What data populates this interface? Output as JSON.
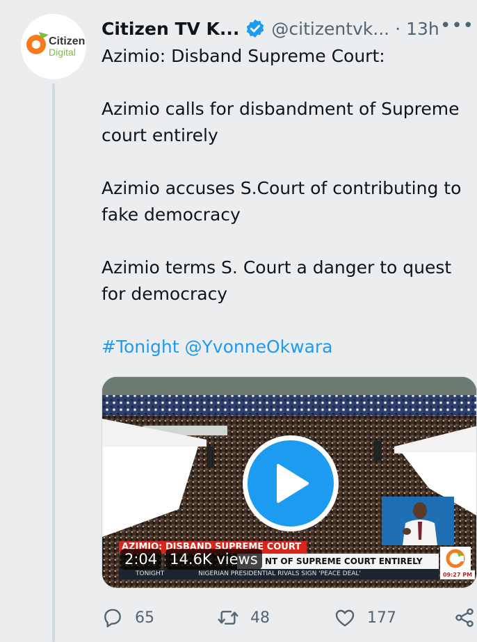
{
  "tweet": {
    "author_name": "Citizen TV K...",
    "handle": "@citizentvk...",
    "separator": "·",
    "time": "13h",
    "more_label": "•••",
    "avatar_logo_line1": "Citizen",
    "avatar_logo_line2": "Digital",
    "text_lines": [
      "Azimio: Disband Supreme Court:",
      "Azimio calls for disbandment of Supreme court entirely",
      "Azimio accuses S.Court of contributing to fake democracy",
      "Azimio terms S. Court a danger to quest for democracy"
    ],
    "hashtag": "#Tonight",
    "mention": "@YvonneOkwara"
  },
  "media": {
    "duration": "2:04",
    "views": "14.6K views",
    "banner_red": "AZIMIO: DISBAND SUPREME COURT",
    "banner_white": "NT OF SUPREME COURT ENTIRELY",
    "ticker_show": "TONIGHT",
    "ticker_text": "NIGERIAN PRESIDENTIAL RIVALS SIGN 'PEACE DEAL'",
    "clock": "09:27 PM"
  },
  "actions": {
    "replies": "65",
    "retweets": "48",
    "likes": "177"
  },
  "colors": {
    "accent": "#1d9bf0",
    "background": "#ecedee",
    "muted": "#536471",
    "brand_orange": "#f47b20",
    "brand_green": "#7bbf3a"
  },
  "icons": {
    "verified": "verified-badge-icon",
    "play": "play-icon",
    "reply": "reply-icon",
    "retweet": "retweet-icon",
    "like": "heart-icon",
    "share": "share-icon"
  }
}
